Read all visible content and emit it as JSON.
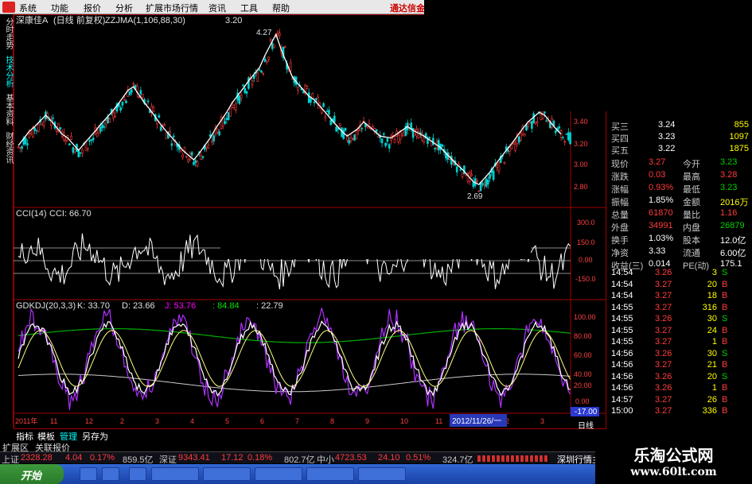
{
  "menu": {
    "items": [
      "系统",
      "功能",
      "报价",
      "分析",
      "扩展市场行情",
      "资讯",
      "工具",
      "帮助"
    ],
    "brand": "通达信金"
  },
  "lefttabs": [
    "分时走势",
    "技术分析",
    "基本资料",
    "财经资讯"
  ],
  "main_pane": {
    "title": "深康佳A",
    "period": "(日线 前复权)",
    "indicator": "ZZJMA(1,106,88,30)",
    "value": "3.20",
    "high_label": "4.27",
    "low_label": "2.69",
    "ticks": [
      "3.40",
      "3.20",
      "3.00",
      "2.80"
    ]
  },
  "cci_pane": {
    "title": "CCI(14)",
    "value": "CCI: 66.70",
    "ticks": [
      "300.0",
      "150.0",
      "0.00",
      "-150.0"
    ]
  },
  "kdj_pane": {
    "title": "GDKDJ(20,3,3)",
    "k": "K: 33.70",
    "d": "D: 23.66",
    "j": "J: 53.76",
    "v1": ": 84.84",
    "v2": ": 22.79",
    "ticks": [
      "100.00",
      "80.00",
      "60.00",
      "40.00",
      "20.00",
      "0.00"
    ],
    "current": "-17.00"
  },
  "x_axis": {
    "labels": [
      "2011年",
      "11",
      "12",
      "2",
      "3",
      "4",
      "5",
      "6",
      "7",
      "8",
      "9",
      "10",
      "11",
      "12",
      "2",
      "3"
    ],
    "cursor_date": "2012/11/26/一"
  },
  "quote": {
    "bids": [
      {
        "label": "买三",
        "price": "3.24",
        "vol": "855"
      },
      {
        "label": "买四",
        "price": "3.23",
        "vol": "1097"
      },
      {
        "label": "买五",
        "price": "3.22",
        "vol": "1875"
      }
    ],
    "stats": [
      {
        "l1": "现价",
        "v1": "3.27",
        "l2": "今开",
        "v2": "3.23"
      },
      {
        "l1": "涨跌",
        "v1": "0.03",
        "l2": "最高",
        "v2": "3.28"
      },
      {
        "l1": "涨幅",
        "v1": "0.93%",
        "l2": "最低",
        "v2": "3.23"
      },
      {
        "l1": "振幅",
        "v1": "1.85%",
        "l2": "金额",
        "v2": "2016万"
      },
      {
        "l1": "总量",
        "v1": "61870",
        "l2": "量比",
        "v2": "1.16"
      },
      {
        "l1": "外盘",
        "v1": "34991",
        "l2": "内盘",
        "v2": "26879"
      },
      {
        "l1": "换手",
        "v1": "1.03%",
        "l2": "股本",
        "v2": "12.0亿"
      },
      {
        "l1": "净资",
        "v1": "3.33",
        "l2": "流通",
        "v2": "6.00亿"
      },
      {
        "l1": "收益(三)",
        "v1": "0.014",
        "l2": "PE(动)",
        "v2": "175.1"
      }
    ],
    "ticks": [
      {
        "t": "14:54",
        "p": "3.26",
        "v": "3",
        "s": "S"
      },
      {
        "t": "14:54",
        "p": "3.27",
        "v": "20",
        "s": "B"
      },
      {
        "t": "14:54",
        "p": "3.27",
        "v": "18",
        "s": "B"
      },
      {
        "t": "14:55",
        "p": "3.27",
        "v": "316",
        "s": "B"
      },
      {
        "t": "14:55",
        "p": "3.26",
        "v": "30",
        "s": "S"
      },
      {
        "t": "14:55",
        "p": "3.27",
        "v": "24",
        "s": "B"
      },
      {
        "t": "14:55",
        "p": "3.27",
        "v": "1",
        "s": "B"
      },
      {
        "t": "14:56",
        "p": "3.26",
        "v": "30",
        "s": "S"
      },
      {
        "t": "14:56",
        "p": "3.27",
        "v": "21",
        "s": "B"
      },
      {
        "t": "14:56",
        "p": "3.26",
        "v": "20",
        "s": "S"
      },
      {
        "t": "14:56",
        "p": "3.26",
        "v": "1",
        "s": "B"
      },
      {
        "t": "14:57",
        "p": "3.27",
        "v": "26",
        "s": "B"
      },
      {
        "t": "15:00",
        "p": "3.27",
        "v": "336",
        "s": "B"
      }
    ],
    "daily_label": "日线"
  },
  "bottom_tabs": [
    "指标",
    "模板",
    "管理",
    "另存为"
  ],
  "stock_tabs": [
    "扩展区",
    "关联报价"
  ],
  "index_bar": {
    "sh_label": "上证",
    "sh_val": "2328.28",
    "sh_chg": "4.04",
    "sh_pct": "0.17%",
    "sh_amt": "859.5亿",
    "sz_label": "深证",
    "sz_val": "9343.41",
    "sz_chg": "17.12",
    "sz_pct": "0.18%",
    "sz_amt": "802.7亿",
    "zx_label": "中小",
    "zx_val": "4723.53",
    "zx_chg": "24.10",
    "zx_pct": "0.51%",
    "zx_amt": "324.7亿",
    "right": "深圳行情主"
  },
  "taskbar": {
    "start": "开始"
  },
  "watermark": {
    "line1": "乐淘公式网",
    "line2": "www.60lt.com"
  },
  "colors": {
    "up": "#ff3c3c",
    "down": "#00d0d0",
    "bg": "#000000",
    "axis": "#a00000"
  },
  "chart_data": {
    "type": "candlestick",
    "note_series": [
      3.1,
      3.18,
      3.25,
      3.3,
      3.38,
      3.42,
      3.36,
      3.3,
      3.22,
      3.18,
      3.1,
      3.05,
      3.12,
      3.18,
      3.25,
      3.32,
      3.4,
      3.45,
      3.52,
      3.6,
      3.68,
      3.72,
      3.65,
      3.55,
      3.48,
      3.4,
      3.32,
      3.25,
      3.18,
      3.12,
      3.05,
      3.0,
      2.95,
      3.02,
      3.1,
      3.18,
      3.28,
      3.36,
      3.45,
      3.55,
      3.62,
      3.7,
      3.78,
      3.85,
      3.92,
      4.05,
      4.18,
      4.27,
      4.1,
      3.95,
      3.82,
      3.75,
      3.7,
      3.62,
      3.58,
      3.52,
      3.45,
      3.38,
      3.3,
      3.25,
      3.2,
      3.22,
      3.28,
      3.35,
      3.3,
      3.25,
      3.2,
      3.15,
      3.18,
      3.22,
      3.28,
      3.3,
      3.26,
      3.22,
      3.2,
      3.16,
      3.12,
      3.08,
      3.02,
      2.96,
      2.9,
      2.85,
      2.78,
      2.72,
      2.69,
      2.75,
      2.82,
      2.9,
      2.98,
      3.05,
      3.12,
      3.2,
      3.28,
      3.35,
      3.4,
      3.45,
      3.42,
      3.35,
      3.28,
      3.22,
      3.2
    ]
  }
}
